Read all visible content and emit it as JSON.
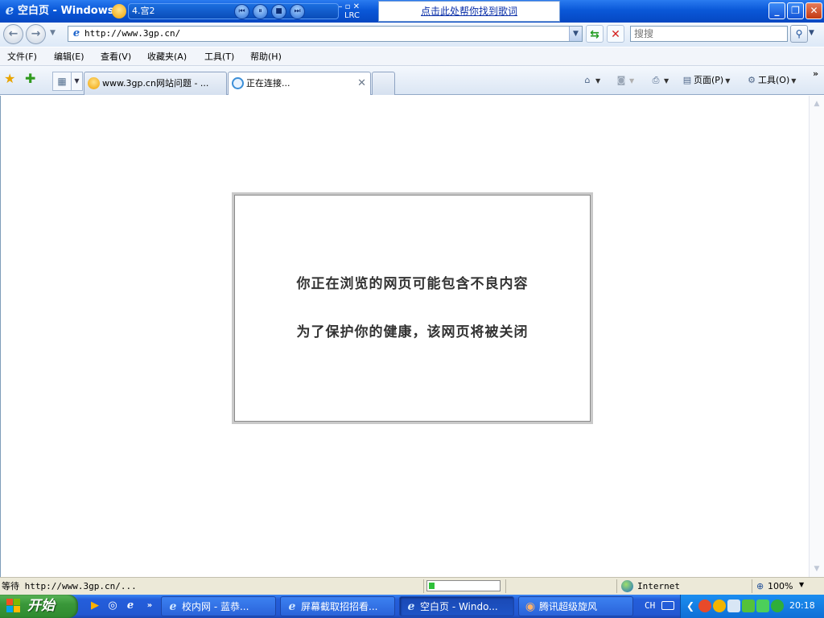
{
  "window": {
    "title": "空白页 - Windows Internet Explorer",
    "min_glyph": "_",
    "max_glyph": "❐",
    "close_glyph": "✕"
  },
  "music_player": {
    "song": "4.宫2",
    "lrc_label": "LRC",
    "lyric_link": "点击此处帮你找到歌词"
  },
  "address": {
    "url": "http://www.3gp.cn/",
    "search_placeholder": "搜搜"
  },
  "menu": {
    "items": [
      {
        "label": "文件(F)"
      },
      {
        "label": "编辑(E)"
      },
      {
        "label": "查看(V)"
      },
      {
        "label": "收藏夹(A)"
      },
      {
        "label": "工具(T)"
      },
      {
        "label": "帮助(H)"
      }
    ]
  },
  "tabs": [
    {
      "label": "www.3gp.cn网站问题 - ..."
    },
    {
      "label": "正在连接..."
    }
  ],
  "command_bar": {
    "page_label": "页面(P)",
    "tools_label": "工具(O)"
  },
  "content": {
    "warning_line_1": "你正在浏览的网页可能包含不良内容",
    "warning_line_2": "为了保护你的健康，该网页将被关闭"
  },
  "status": {
    "text": "等待 http://www.3gp.cn/...",
    "progress": 0.08,
    "zone": "Internet",
    "zoom": "100%"
  },
  "taskbar": {
    "start_label": "开始",
    "tasks": [
      {
        "label": "校内网 - 蓝恭..."
      },
      {
        "label": "屏幕截取招招看..."
      },
      {
        "label": "空白页 - Windo..."
      },
      {
        "label": "腾讯超级旋风"
      }
    ],
    "language": "CH",
    "clock": "20:18"
  },
  "colors": {
    "title_bar": "#0a58d8",
    "taskbar": "#245edb",
    "start_button": "#3a973a",
    "progress_fill": "#2fc03a"
  }
}
